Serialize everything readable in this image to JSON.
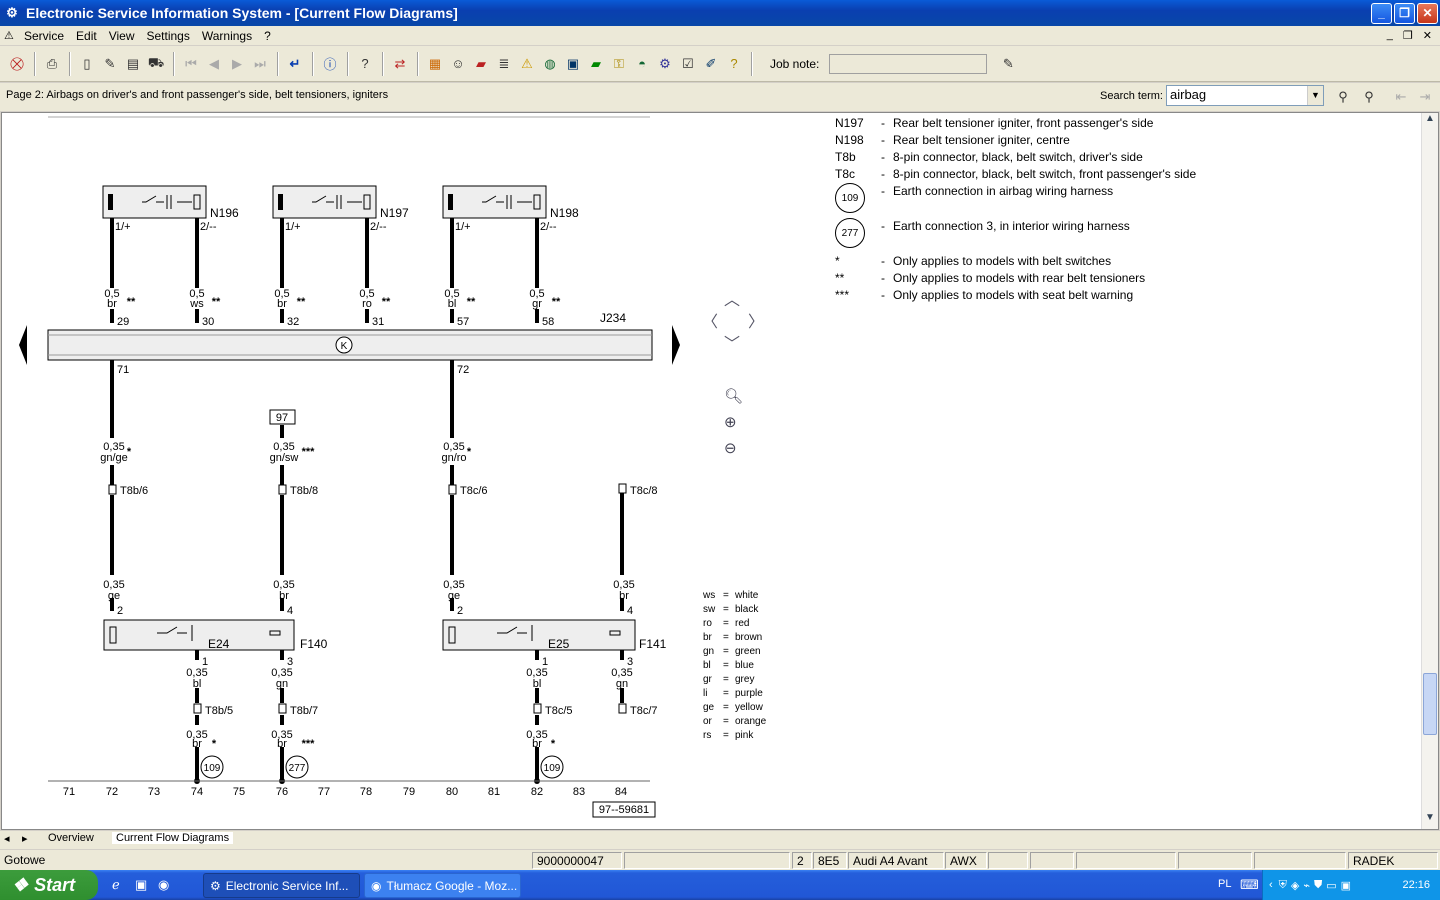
{
  "window": {
    "title": "Electronic Service Information System - [Current Flow Diagrams]"
  },
  "menu": {
    "items": [
      "Service",
      "Edit",
      "View",
      "Settings",
      "Warnings",
      "?"
    ]
  },
  "toolbar": {
    "job_note_label": "Job note:",
    "job_note_value": ""
  },
  "page": {
    "title": "Page 2: Airbags on driver's and front passenger's side, belt tensioners, igniters"
  },
  "search": {
    "label": "Search term:",
    "value": "airbag"
  },
  "legend": {
    "rows": [
      {
        "code": "N197",
        "text": "Rear belt tensioner igniter, front passenger's side"
      },
      {
        "code": "N198",
        "text": "Rear belt tensioner igniter, centre"
      },
      {
        "code": "T8b",
        "text": "8-pin connector, black, belt switch, driver's side"
      },
      {
        "code": "T8c",
        "text": "8-pin connector, black, belt switch, front passenger's side"
      }
    ],
    "earth": [
      {
        "code": "109",
        "text": "Earth connection in airbag wiring harness"
      },
      {
        "code": "277",
        "text": "Earth connection 3, in interior wiring harness"
      }
    ],
    "notes": [
      {
        "code": "*",
        "text": "Only applies to models with belt switches"
      },
      {
        "code": "**",
        "text": "Only applies to models with rear belt tensioners"
      },
      {
        "code": "***",
        "text": "Only applies to models with seat belt warning"
      }
    ]
  },
  "color_key": [
    {
      "abbr": "ws",
      "name": "white"
    },
    {
      "abbr": "sw",
      "name": "black"
    },
    {
      "abbr": "ro",
      "name": "red"
    },
    {
      "abbr": "br",
      "name": "brown"
    },
    {
      "abbr": "gn",
      "name": "green"
    },
    {
      "abbr": "bl",
      "name": "blue"
    },
    {
      "abbr": "gr",
      "name": "grey"
    },
    {
      "abbr": "li",
      "name": "purple"
    },
    {
      "abbr": "ge",
      "name": "yellow"
    },
    {
      "abbr": "or",
      "name": "orange"
    },
    {
      "abbr": "rs",
      "name": "pink"
    }
  ],
  "diagram": {
    "components": {
      "n196": "N196",
      "n197": "N197",
      "n198": "N198",
      "j234": "J234",
      "e24": "E24",
      "f140": "F140",
      "e25": "E25",
      "f141": "F141"
    },
    "pin_top": [
      "1/+",
      "2/--",
      "1/+",
      "2/--",
      "1/+",
      "2/--"
    ],
    "wire_top_size": [
      "0,5",
      "0,5",
      "0,5",
      "0,5",
      "0,5",
      "0,5"
    ],
    "wire_top_color": [
      "br",
      "ws",
      "br",
      "ro",
      "bl",
      "gr"
    ],
    "wire_top_mark": "**",
    "j234_pins_top": [
      "29",
      "30",
      "32",
      "31",
      "57",
      "58"
    ],
    "j234_pins_bottom": [
      "71",
      "72"
    ],
    "ref_box": "97",
    "mid_wires": [
      {
        "size": "0,35",
        "mark": "*",
        "color": "gn/ge",
        "conn": "T8b/6"
      },
      {
        "size": "0,35",
        "mark": "***",
        "color": "gn/sw",
        "conn": "T8b/8"
      },
      {
        "size": "0,35",
        "mark": "*",
        "color": "gn/ro",
        "conn": "T8c/6"
      },
      {
        "size": "",
        "mark": "",
        "color": "",
        "conn": "T8c/8"
      }
    ],
    "low_wires": [
      {
        "size": "0,35",
        "color": "ge",
        "pin": "2"
      },
      {
        "size": "0,35",
        "color": "br",
        "pin": "4"
      },
      {
        "size": "0,35",
        "color": "ge",
        "pin": "2"
      },
      {
        "size": "0,35",
        "color": "br",
        "pin": "4"
      }
    ],
    "bottom_wires": [
      {
        "pin": "1",
        "size": "0,35",
        "color": "bl",
        "conn": "T8b/5",
        "size2": "0,35",
        "color2": "br",
        "mark": "*",
        "earth": "109"
      },
      {
        "pin": "3",
        "size": "0,35",
        "color": "gn",
        "conn": "T8b/7",
        "size2": "0,35",
        "color2": "br",
        "mark": "***",
        "earth": "277"
      },
      {
        "pin": "1",
        "size": "0,35",
        "color": "bl",
        "conn": "T8c/5",
        "size2": "0,35",
        "color2": "br",
        "mark": "*",
        "earth": "109"
      },
      {
        "pin": "3",
        "size": "0,35",
        "color": "gn",
        "conn": "T8c/7",
        "size2": "",
        "color2": "",
        "mark": "",
        "earth": ""
      }
    ],
    "scale": [
      "71",
      "72",
      "73",
      "74",
      "75",
      "76",
      "77",
      "78",
      "79",
      "80",
      "81",
      "82",
      "83",
      "84"
    ],
    "drawing_no": "97--59681"
  },
  "tabs": [
    "Overview",
    "Current Flow Diagrams"
  ],
  "status": {
    "text": "Gotowe",
    "number": "9000000047",
    "page": "2",
    "code": "8E5",
    "model": "Audi A4 Avant",
    "engine": "AWX",
    "user": "RADEK"
  },
  "taskbar": {
    "start": "Start",
    "tasks": [
      "Electronic Service Inf...",
      "Tłumacz Google - Moz..."
    ],
    "lang": "PL",
    "clock": "22:16"
  }
}
